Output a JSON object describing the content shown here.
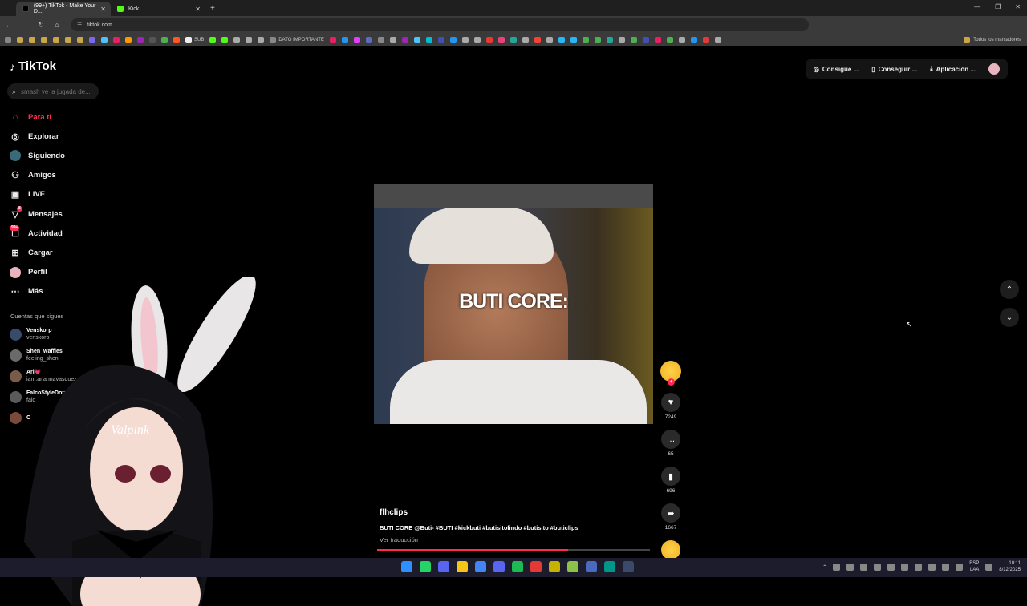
{
  "browser": {
    "tabs": [
      {
        "label": "(99+) TikTok - Make Your D...",
        "active": true
      },
      {
        "label": "Kick",
        "active": false
      }
    ],
    "url": "tiktok.com",
    "bookmarks_right": "Todos los marcadores",
    "bookmark_sub": "SUB",
    "bookmark_dato": "DATO IMPORTANTE"
  },
  "tiktok": {
    "logo": "TikTok",
    "search_placeholder": "smash ve la jugada de...",
    "nav": [
      {
        "label": "Para ti",
        "icon": "home-icon",
        "active": true
      },
      {
        "label": "Explorar",
        "icon": "compass-icon"
      },
      {
        "label": "Siguiendo",
        "icon": "following-icon"
      },
      {
        "label": "Amigos",
        "icon": "friends-icon"
      },
      {
        "label": "LIVE",
        "icon": "live-icon"
      },
      {
        "label": "Mensajes",
        "icon": "messages-icon",
        "badge": "8"
      },
      {
        "label": "Actividad",
        "icon": "activity-icon",
        "badge": "99+"
      },
      {
        "label": "Cargar",
        "icon": "upload-icon"
      },
      {
        "label": "Perfil",
        "icon": "profile-icon"
      },
      {
        "label": "Más",
        "icon": "more-icon"
      }
    ],
    "following_title": "Cuentas que sigues",
    "following": [
      {
        "name": "Venskorp",
        "handle": "venskorp"
      },
      {
        "name": "Shen_waffles",
        "handle": "feeling_shen"
      },
      {
        "name": "Ari💗",
        "handle": "iam.ariannavasquez"
      },
      {
        "name": "FalcoStyleDota",
        "handle": "falc"
      },
      {
        "name": "C",
        "handle": ""
      }
    ],
    "topright": {
      "coins": "Consigue ...",
      "get": "Conseguir ...",
      "app": "Aplicación ..."
    },
    "video": {
      "caption_overlay": "BUTI CORE:",
      "author": "flhclips",
      "description": "BUTI CORE @Buti- #BUTI #kickbuti #butisitolindo #butisito #buticlips",
      "translate": "Ver traducción",
      "progress": 0.7
    },
    "actions": {
      "likes": "7249",
      "comments": "65",
      "saves": "696",
      "shares": "1667"
    }
  },
  "overlay": {
    "vtuber_name": "Valpink"
  },
  "taskbar": {
    "lang": "ESP",
    "lang2": "LAA",
    "time": "10:11",
    "date": "8/12/2025"
  }
}
